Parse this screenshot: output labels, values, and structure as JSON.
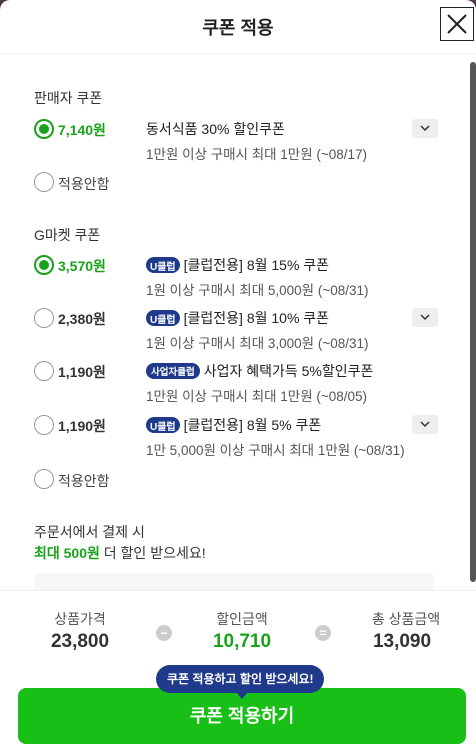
{
  "modal": {
    "title": "쿠폰 적용"
  },
  "seller_section": {
    "title": "판매자 쿠폰",
    "coupons": [
      {
        "amount": "7,140원",
        "name": "동서식품 30% 할인쿠폰",
        "desc": "1만원 이상 구매시 최대 1만원 (~08/17)",
        "selected": true
      }
    ],
    "none_label": "적용안함"
  },
  "gmarket_section": {
    "title": "G마켓 쿠폰",
    "coupons": [
      {
        "amount": "3,570원",
        "badge": "U클럽",
        "name": "[클럽전용] 8월 15% 쿠폰",
        "desc": "1원 이상 구매시 최대 5,000원 (~08/31)",
        "selected": true
      },
      {
        "amount": "2,380원",
        "badge": "U클럽",
        "name": "[클럽전용] 8월 10% 쿠폰",
        "desc": "1원 이상 구매시 최대 3,000원 (~08/31)",
        "selected": false
      },
      {
        "amount": "1,190원",
        "badge": "사업자클럽",
        "name": "사업자 혜택가득 5%할인쿠폰",
        "desc": "1만원 이상 구매시 최대 1만원 (~08/05)",
        "selected": false
      },
      {
        "amount": "1,190원",
        "badge": "U클럽",
        "name": "[클럽전용] 8월 5% 쿠폰",
        "desc": "1만 5,000원 이상 구매시 최대 1만원 (~08/31)",
        "selected": false
      }
    ],
    "none_label": "적용안함"
  },
  "promo": {
    "line1": "주문서에서 결제 시",
    "highlight": "최대 500원",
    "line2_rest": " 더 할인 받으세요!"
  },
  "summary": {
    "price_label": "상품가격",
    "price_value": "23,800",
    "minus_symbol": "−",
    "discount_label": "할인금액",
    "discount_value": "10,710",
    "equals_symbol": "=",
    "total_label": "총 상품금액",
    "total_value": "13,090"
  },
  "tooltip": "쿠폰 적용하고 할인 받으세요!",
  "apply_button": "쿠폰 적용하기",
  "colors": {
    "accent_green": "#1aa31a",
    "button_green": "#17bf17",
    "badge_navy": "#1f3a8a"
  }
}
